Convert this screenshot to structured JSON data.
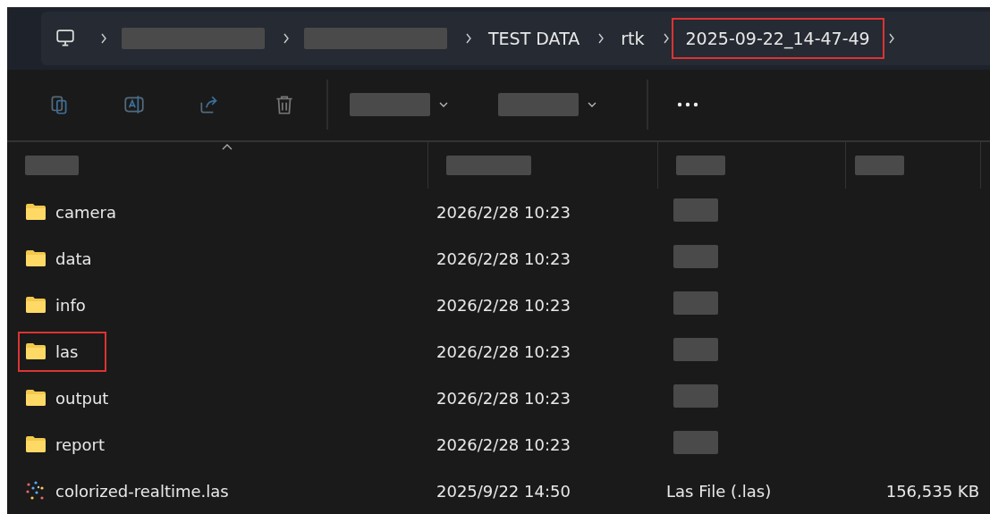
{
  "breadcrumb": [
    {
      "kind": "redacted"
    },
    {
      "kind": "redacted"
    },
    {
      "kind": "text",
      "label": "TEST DATA",
      "highlighted": false
    },
    {
      "kind": "text",
      "label": "rtk",
      "highlighted": false
    },
    {
      "kind": "text",
      "label": "2025-09-22_14-47-49",
      "highlighted": true
    }
  ],
  "files": [
    {
      "kind": "folder",
      "name": "camera",
      "modified": "2026/2/28 10:23",
      "highlighted": false
    },
    {
      "kind": "folder",
      "name": "data",
      "modified": "2026/2/28 10:23",
      "highlighted": false
    },
    {
      "kind": "folder",
      "name": "info",
      "modified": "2026/2/28 10:23",
      "highlighted": false
    },
    {
      "kind": "folder",
      "name": "las",
      "modified": "2026/2/28 10:23",
      "highlighted": true
    },
    {
      "kind": "folder",
      "name": "output",
      "modified": "2026/2/28 10:23",
      "highlighted": false
    },
    {
      "kind": "folder",
      "name": "report",
      "modified": "2026/2/28 10:23",
      "highlighted": false
    },
    {
      "kind": "file",
      "name": "colorized-realtime.las",
      "modified": "2025/9/22 14:50",
      "type": "Las File (.las)",
      "size": "156,535 KB",
      "highlighted": false
    }
  ]
}
